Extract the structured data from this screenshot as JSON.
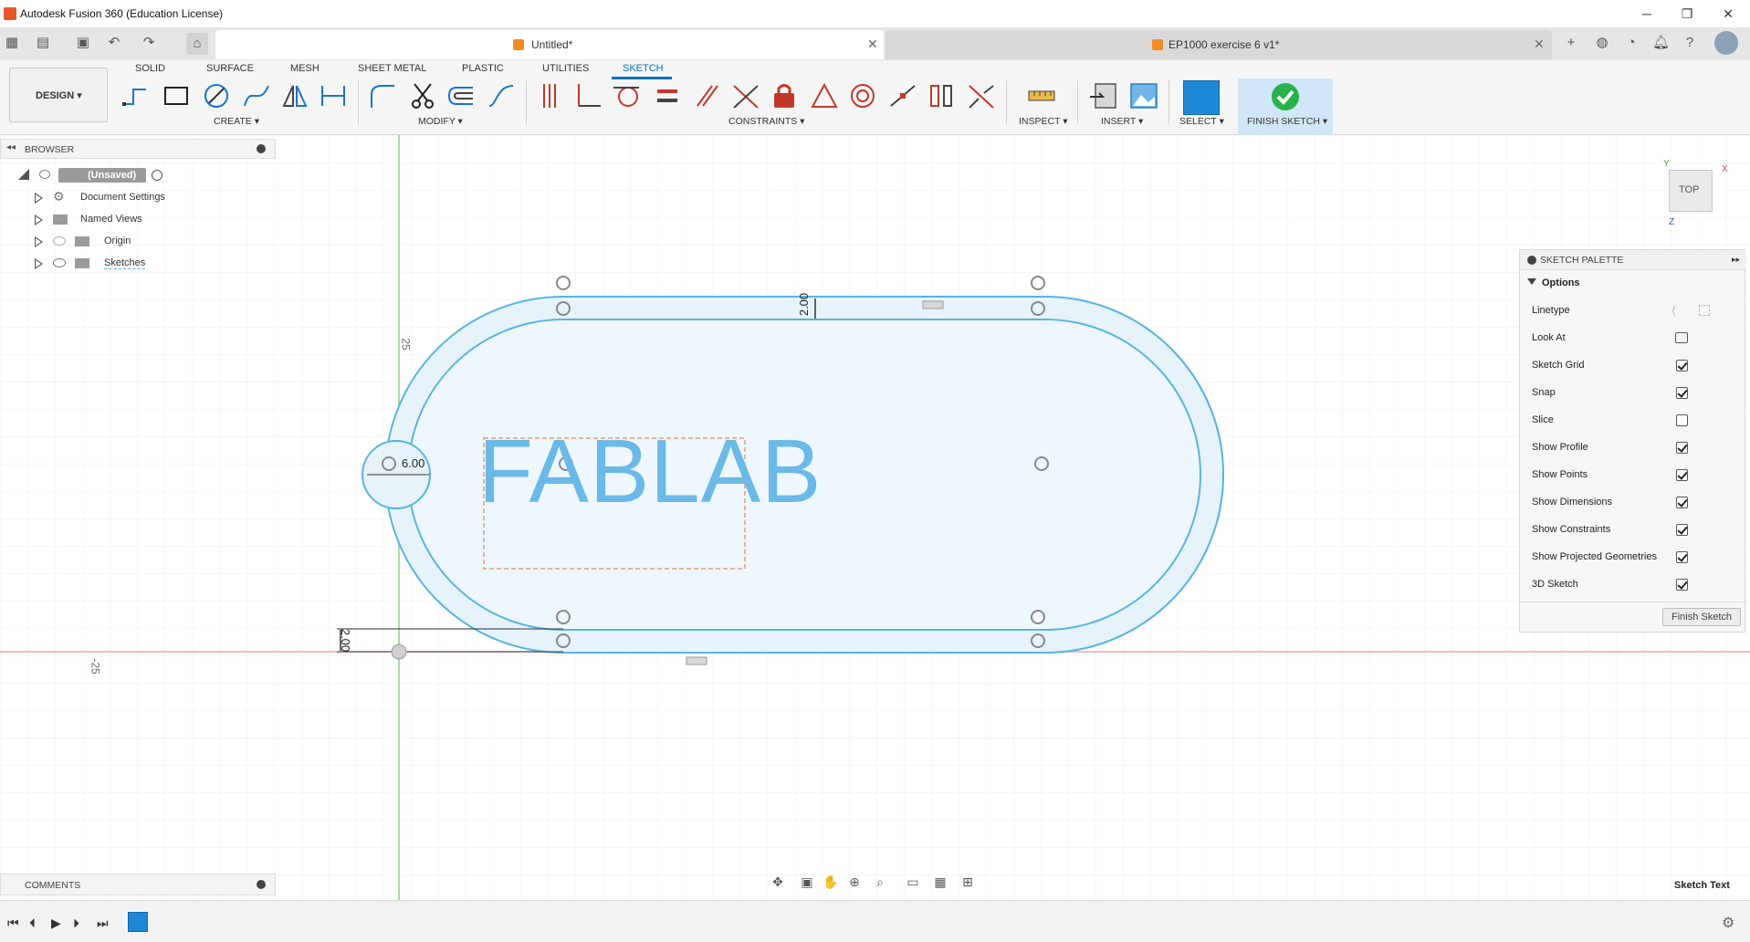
{
  "window": {
    "title": "Autodesk Fusion 360 (Education License)",
    "controls": {
      "minimize": "─",
      "maximize": "❐",
      "close": "✕"
    }
  },
  "tabs": [
    {
      "label": "Untitled*",
      "active": true
    },
    {
      "label": "EP1000 exercise 6 v1*",
      "active": false
    }
  ],
  "ribbon": {
    "workspace": "DESIGN ▾",
    "tabs": [
      "SOLID",
      "SURFACE",
      "MESH",
      "SHEET METAL",
      "PLASTIC",
      "UTILITIES",
      "SKETCH"
    ],
    "active_tab": "SKETCH",
    "groups": [
      "CREATE ▾",
      "MODIFY ▾",
      "CONSTRAINTS ▾",
      "INSPECT ▾",
      "INSERT ▾",
      "SELECT ▾",
      "FINISH SKETCH ▾"
    ]
  },
  "browser": {
    "header": "BROWSER",
    "items": [
      {
        "label": "(Unsaved)"
      },
      {
        "label": "Document Settings"
      },
      {
        "label": "Named Views"
      },
      {
        "label": "Origin"
      },
      {
        "label": "Sketches"
      }
    ]
  },
  "comments": {
    "label": "COMMENTS"
  },
  "viewcube": {
    "face": "TOP",
    "x": "X",
    "y": "Y",
    "z": "Z"
  },
  "sketch": {
    "text": "FABLAB",
    "dimensions": [
      "2.00",
      "2.00",
      "6.00"
    ],
    "axis_labels": [
      "25",
      "-25"
    ]
  },
  "palette": {
    "header": "SKETCH PALETTE",
    "section": "Options",
    "rows": [
      {
        "label": "Linetype",
        "kind": "icons"
      },
      {
        "label": "Look At",
        "kind": "icon"
      },
      {
        "label": "Sketch Grid",
        "checked": true
      },
      {
        "label": "Snap",
        "checked": true
      },
      {
        "label": "Slice",
        "checked": false
      },
      {
        "label": "Show Profile",
        "checked": true
      },
      {
        "label": "Show Points",
        "checked": true
      },
      {
        "label": "Show Dimensions",
        "checked": true
      },
      {
        "label": "Show Constraints",
        "checked": true
      },
      {
        "label": "Show Projected Geometries",
        "checked": true
      },
      {
        "label": "3D Sketch",
        "checked": true
      }
    ],
    "finish_button": "Finish Sketch"
  },
  "status": {
    "text": "Sketch Text"
  },
  "colors": {
    "accent": "#0a6fc2",
    "sketch_line": "#5ab4e0",
    "sketch_fill": "#e6f3fb",
    "finish_green": "#27b24a"
  }
}
